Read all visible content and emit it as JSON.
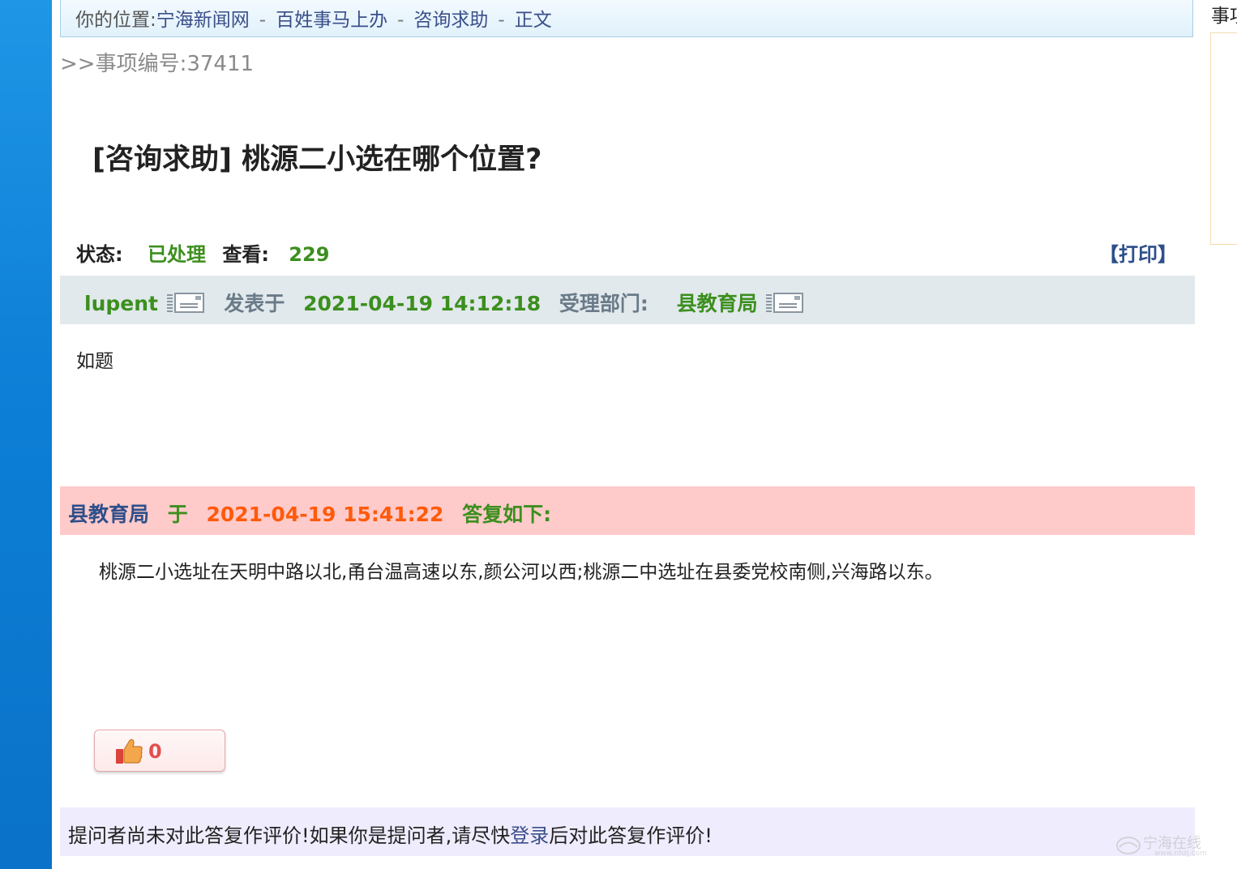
{
  "breadcrumb": {
    "prefix": "你的位置:",
    "items": [
      "宁海新闻网",
      "百姓事马上办",
      "咨询求助",
      "正文"
    ],
    "separator": "-"
  },
  "item_number": ">>事项编号:37411",
  "title": "[咨询求助] 桃源二小选在哪个位置?",
  "status": {
    "label": "状态:",
    "value": "已处理",
    "views_label": "查看:",
    "views_value": "229",
    "print_label": "【打印】"
  },
  "post": {
    "author": "lupent",
    "posted_label": "发表于",
    "posted_time": "2021-04-19 14:12:18",
    "dept_label": "受理部门:",
    "dept_value": "县教育局",
    "body": "如题"
  },
  "reply": {
    "dept": "县教育局",
    "at_label": "于",
    "time": "2021-04-19 15:41:22",
    "reply_label": "答复如下:",
    "body": "桃源二小选址在天明中路以北,甬台温高速以东,颜公河以西;桃源二中选址在县委党校南侧,兴海路以东。"
  },
  "like": {
    "count": "0"
  },
  "evaluation": {
    "text_before": "提问者尚未对此答复作评价!如果你是提问者,请尽快",
    "login_link": "登录",
    "text_after": "后对此答复作评价!"
  },
  "right_edge_text": "事项",
  "watermark": {
    "text": "宁海在线",
    "url": "www.nhzj.com"
  },
  "colors": {
    "accent_green": "#3c8f1e",
    "accent_orange": "#ff5a0a",
    "link_blue": "#2e4f8a",
    "reply_bar_bg": "#ffcaca",
    "poster_bar_bg": "#e1e9ec",
    "eval_bar_bg": "#efecfd"
  }
}
